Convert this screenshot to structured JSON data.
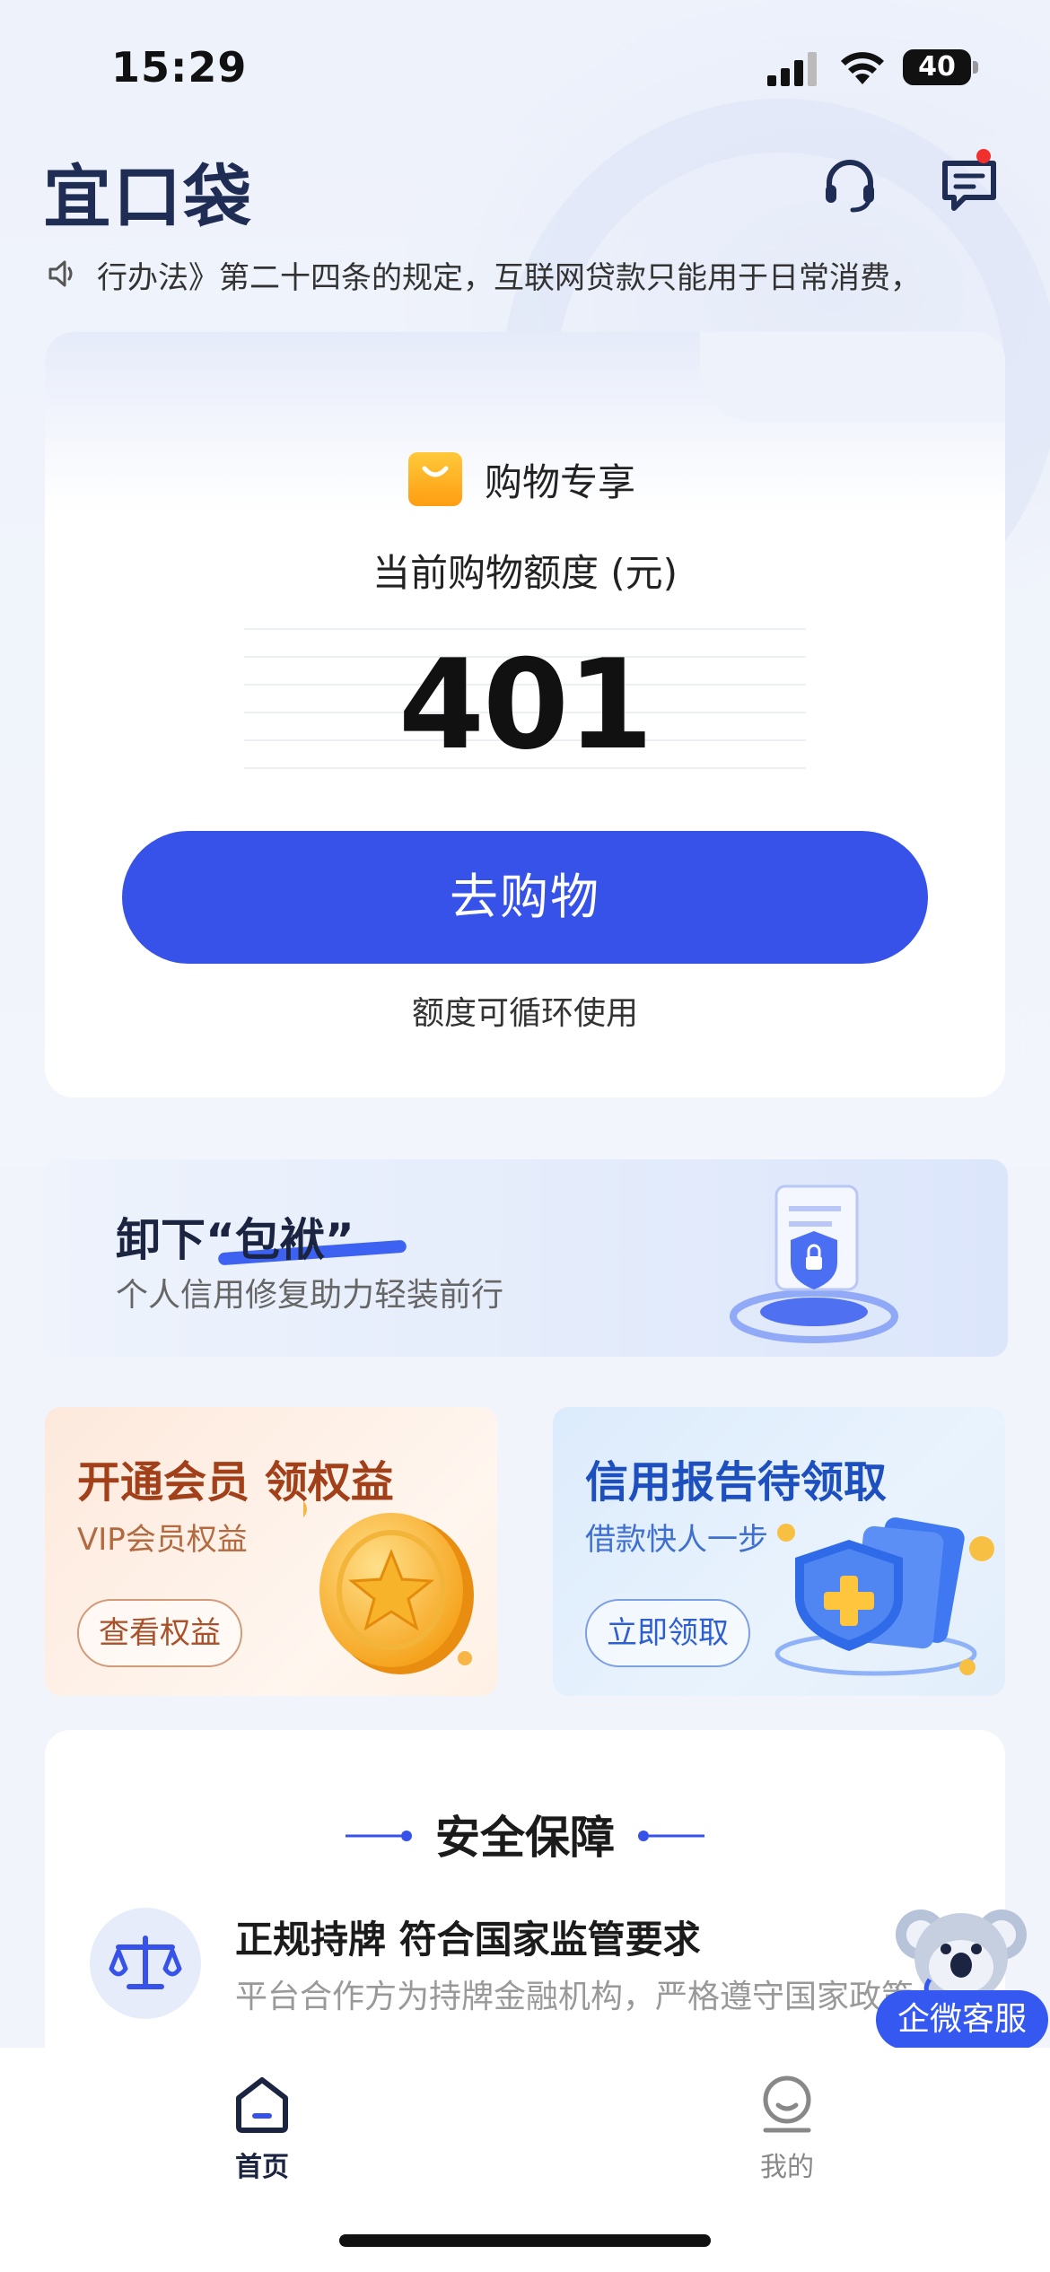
{
  "status_bar": {
    "time": "15:29",
    "battery": "40"
  },
  "header": {
    "logo": "宜口袋"
  },
  "notice": {
    "text": "行办法》第二十四条的规定，互联网贷款只能用于日常消费，"
  },
  "credit_card": {
    "label": "购物专享",
    "title": "当前购物额度 (元)",
    "amount": "401",
    "button": "去购物",
    "note": "额度可循环使用"
  },
  "banner": {
    "title": "卸下“包袱”",
    "subtitle": "个人信用修复助力轻装前行"
  },
  "promo_vip": {
    "title": "开通会员 领权益",
    "subtitle": "VIP会员权益",
    "button": "查看权益"
  },
  "promo_report": {
    "title": "信用报告待领取",
    "subtitle": "借款快人一步",
    "button": "立即领取"
  },
  "security": {
    "title": "安全保障",
    "item_title": "正规持牌 符合国家监管要求",
    "item_desc": "平台合作方为持牌金融机构，严格遵守国家政策"
  },
  "float_service": {
    "label": "企微客服"
  },
  "tabbar": {
    "home": "首页",
    "mine": "我的"
  },
  "colors": {
    "primary": "#3752e8",
    "logo": "#1f2d55",
    "badge": "#f0302c",
    "vip": "#a2401a"
  }
}
